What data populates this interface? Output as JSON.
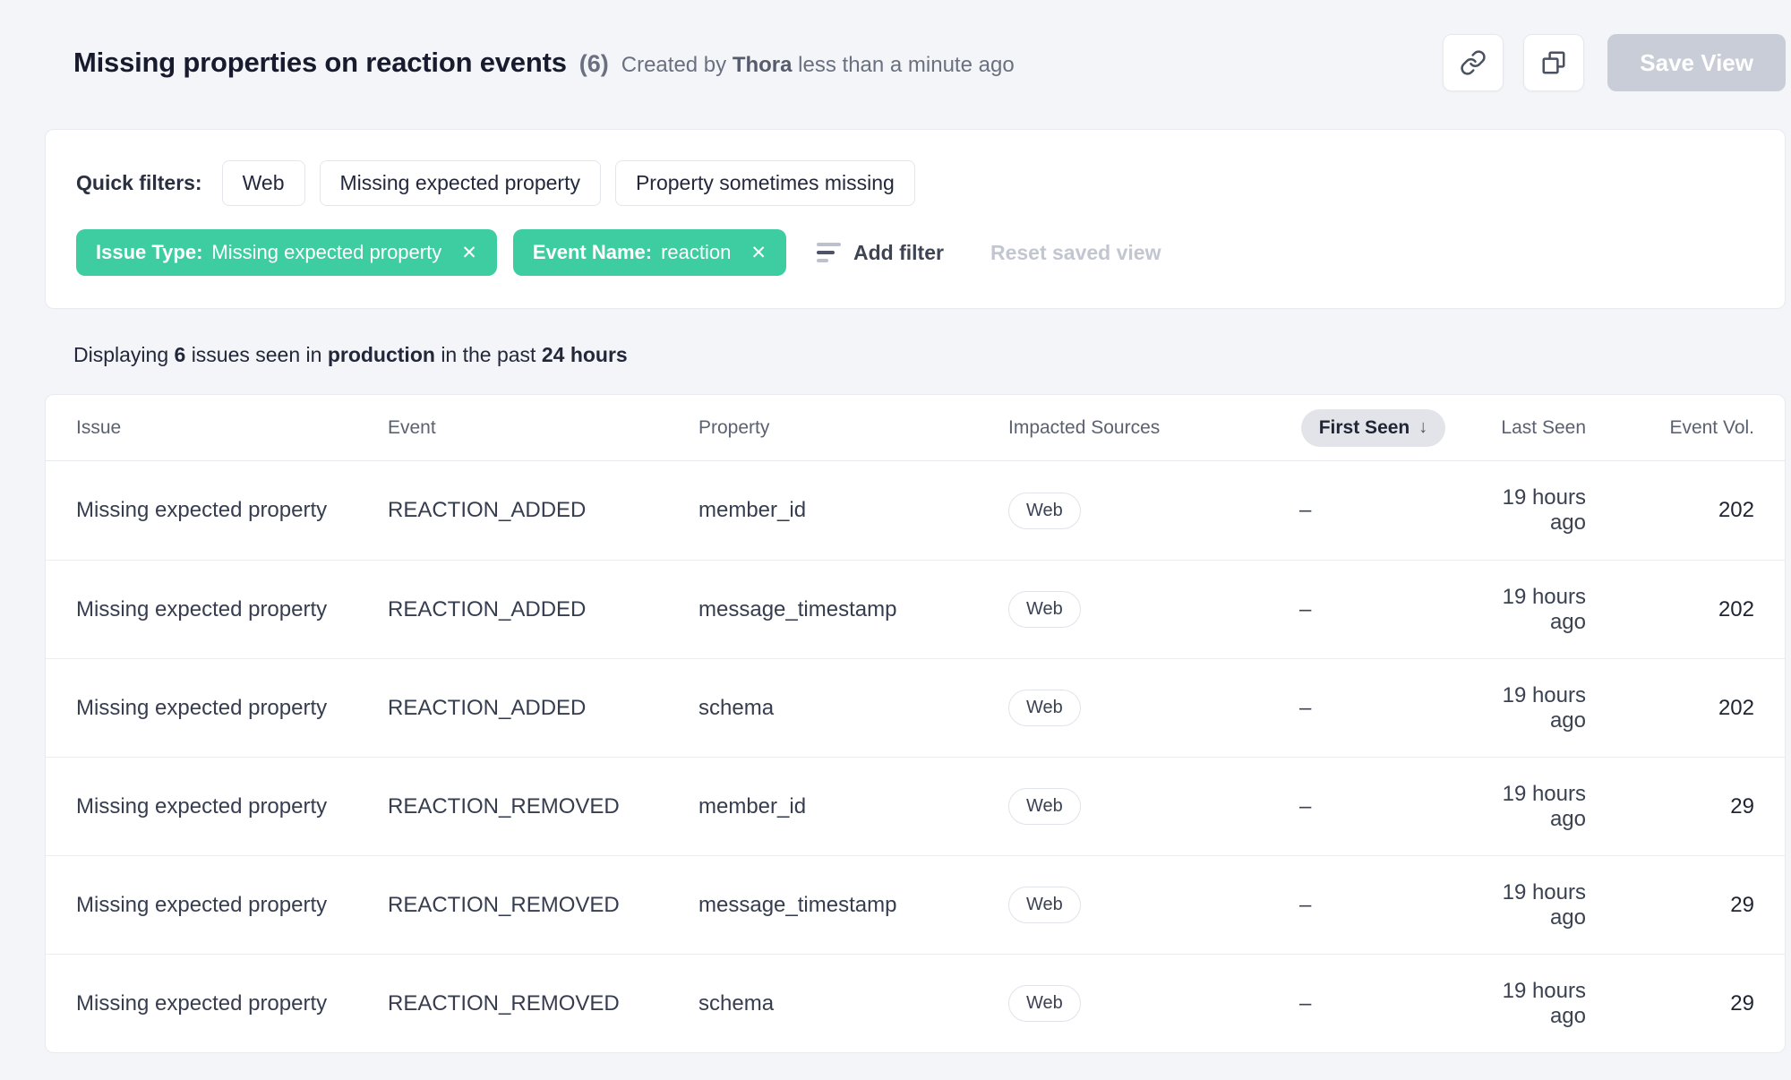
{
  "icons": {
    "close_glyph": "✕",
    "sort_down_glyph": "↓"
  },
  "colors": {
    "accent_green": "#3ecda0",
    "page_background": "#f4f5f8",
    "disabled_button": "#c9cdd8"
  },
  "header": {
    "title": "Missing properties on reaction events",
    "count": "(6)",
    "created_prefix": "Created by",
    "created_by": "Thora",
    "created_suffix": "less than a minute ago",
    "save_view_label": "Save View"
  },
  "filters": {
    "quick_filters_label": "Quick filters:",
    "quick_filters": [
      "Web",
      "Missing expected property",
      "Property sometimes missing"
    ],
    "active_filters": [
      {
        "label": "Issue Type:",
        "value": "Missing expected property"
      },
      {
        "label": "Event Name:",
        "value": "reaction"
      }
    ],
    "add_filter_label": "Add filter",
    "reset_label": "Reset saved view"
  },
  "summary": {
    "prefix": "Displaying",
    "count": "6",
    "mid1": "issues seen in",
    "environment": "production",
    "mid2": "in the past",
    "range": "24 hours"
  },
  "table": {
    "columns": [
      "Issue",
      "Event",
      "Property",
      "Impacted Sources",
      "First Seen",
      "Last Seen",
      "Event Vol."
    ],
    "sorted_by": "First Seen",
    "sort_direction": "descending",
    "rows": [
      {
        "issue": "Missing expected property",
        "event": "REACTION_ADDED",
        "property": "member_id",
        "sources": [
          "Web"
        ],
        "first_seen": "–",
        "last_seen": "19 hours ago",
        "event_vol": "202"
      },
      {
        "issue": "Missing expected property",
        "event": "REACTION_ADDED",
        "property": "message_timestamp",
        "sources": [
          "Web"
        ],
        "first_seen": "–",
        "last_seen": "19 hours ago",
        "event_vol": "202"
      },
      {
        "issue": "Missing expected property",
        "event": "REACTION_ADDED",
        "property": "schema",
        "sources": [
          "Web"
        ],
        "first_seen": "–",
        "last_seen": "19 hours ago",
        "event_vol": "202"
      },
      {
        "issue": "Missing expected property",
        "event": "REACTION_REMOVED",
        "property": "member_id",
        "sources": [
          "Web"
        ],
        "first_seen": "–",
        "last_seen": "19 hours ago",
        "event_vol": "29"
      },
      {
        "issue": "Missing expected property",
        "event": "REACTION_REMOVED",
        "property": "message_timestamp",
        "sources": [
          "Web"
        ],
        "first_seen": "–",
        "last_seen": "19 hours ago",
        "event_vol": "29"
      },
      {
        "issue": "Missing expected property",
        "event": "REACTION_REMOVED",
        "property": "schema",
        "sources": [
          "Web"
        ],
        "first_seen": "–",
        "last_seen": "19 hours ago",
        "event_vol": "29"
      }
    ]
  }
}
